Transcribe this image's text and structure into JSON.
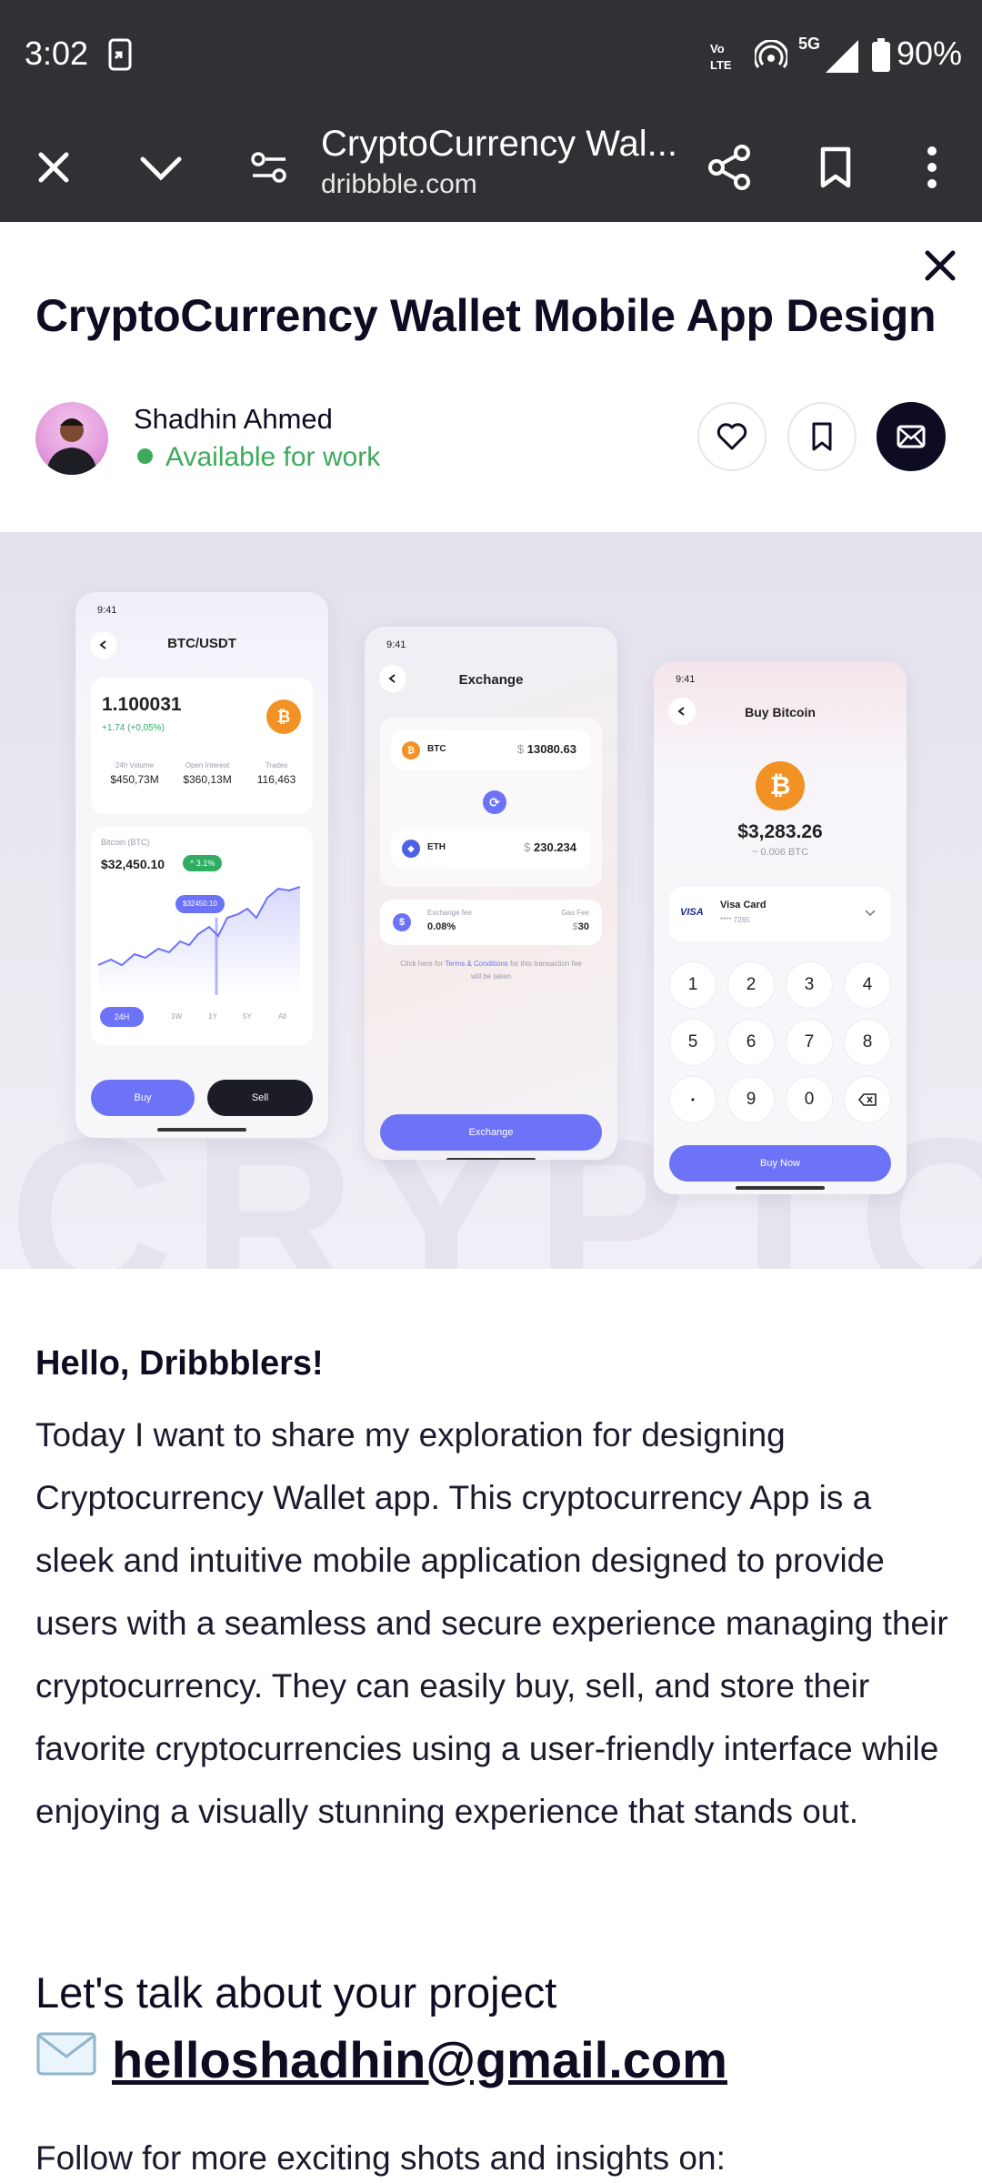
{
  "status_bar": {
    "time": "3:02",
    "network": "5G",
    "battery": "90%"
  },
  "toolbar": {
    "title": "CryptoCurrency Wal...",
    "url": "dribbble.com"
  },
  "shot": {
    "title": "CryptoCurrency Wallet Mobile App Design",
    "author": "Shadhin Ahmed",
    "availability": "Available for work"
  },
  "mockups": {
    "background_word": "CRYPTO",
    "phone1": {
      "time": "9:41",
      "pair": "BTC/USDT",
      "amount": "1.100031",
      "change": "+1.74 (+0,05%)",
      "stats": [
        {
          "label": "24h Volume",
          "value": "$450,73M"
        },
        {
          "label": "Open Interest",
          "value": "$360,13M"
        },
        {
          "label": "Trades",
          "value": "116,463"
        }
      ],
      "chart_label": "Bitcoin (BTC)",
      "price": "$32,450.10",
      "badge": "3.1%",
      "tooltip": "$32450.10",
      "ranges": [
        "24H",
        "1W",
        "1Y",
        "5Y",
        "All"
      ],
      "buy": "Buy",
      "sell": "Sell"
    },
    "phone2": {
      "time": "9:41",
      "title": "Exchange",
      "from_coin": "BTC",
      "from_value": "13080.63",
      "to_coin": "ETH",
      "to_value": "230.234",
      "fee_label": "Exchange fee",
      "fee_value": "0.08%",
      "gas_label": "Gas Fee",
      "gas_value": "30",
      "terms_pre": "Click here for",
      "terms_link": "Terms & Conditions",
      "terms_post": "for this transaction fee will be taken",
      "button": "Exchange"
    },
    "phone3": {
      "time": "9:41",
      "title": "Buy Bitcoin",
      "amount": "$3,283.26",
      "btc": "~ 0.006 BTC",
      "card_brand": "VISA",
      "card_name": "Visa Card",
      "card_number": "**** 7265",
      "keys": [
        "1",
        "2",
        "3",
        "4",
        "5",
        "6",
        "7",
        "8",
        "•",
        "9",
        "0"
      ],
      "button": "Buy Now"
    }
  },
  "description": {
    "heading": "Hello, Dribbblers!",
    "body": "Today I want to share my exploration for designing Cryptocurrency Wallet app. This cryptocurrency App is a sleek and intuitive mobile application designed to provide users with a seamless and secure experience managing their cryptocurrency. They can easily buy, sell, and store their favorite cryptocurrencies using a user-friendly interface while enjoying a visually stunning experience that stands out.",
    "talk": "Let's talk about your project",
    "email": "helloshadhin@gmail.com",
    "follow": "Follow for more exciting shots and insights on:"
  }
}
